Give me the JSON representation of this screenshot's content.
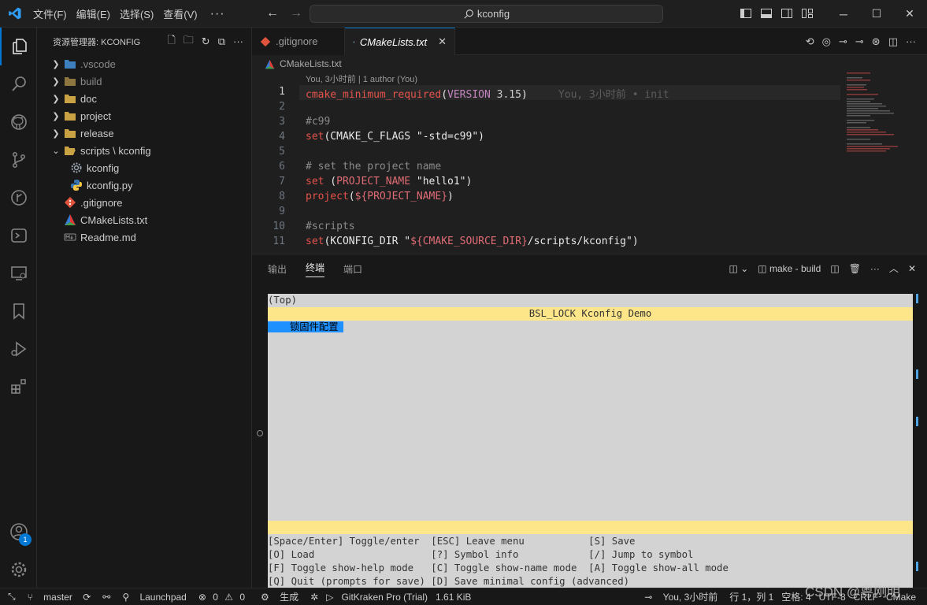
{
  "titlebar": {
    "menu": [
      "文件(F)",
      "编辑(E)",
      "选择(S)",
      "查看(V)",
      "···"
    ],
    "search_text": "kconfig"
  },
  "sidebar": {
    "title": "资源管理器: KCONFIG",
    "items": [
      {
        "label": ".vscode",
        "kind": "folder"
      },
      {
        "label": "build",
        "kind": "folder"
      },
      {
        "label": "doc",
        "kind": "folder"
      },
      {
        "label": "project",
        "kind": "folder"
      },
      {
        "label": "release",
        "kind": "folder"
      },
      {
        "label": "scripts \\ kconfig",
        "kind": "folder-open"
      },
      {
        "label": "kconfig",
        "kind": "gear-file"
      },
      {
        "label": "kconfig.py",
        "kind": "python-file"
      },
      {
        "label": ".gitignore",
        "kind": "git-file"
      },
      {
        "label": "CMakeLists.txt",
        "kind": "cmake-file"
      },
      {
        "label": "Readme.md",
        "kind": "markdown-file"
      }
    ]
  },
  "editor": {
    "tabs": [
      {
        "label": ".gitignore",
        "active": false
      },
      {
        "label": "CMakeLists.txt",
        "active": true
      }
    ],
    "breadcrumb": "CMakeLists.txt",
    "codelens": "You, 3小时前 | 1 author (You)",
    "inline_blame": "You, 3小时前 • init",
    "line_numbers": [
      "1",
      "2",
      "3",
      "4",
      "5",
      "6",
      "7",
      "8",
      "9",
      "10",
      "11"
    ],
    "code": {
      "l1_fn": "cmake_minimum_required",
      "l1_open": "(",
      "l1_kw": "VERSION",
      "l1_num": " 3.15",
      "l1_close": ")",
      "l3": "#c99",
      "l4_fn": "set",
      "l4_rest": "(CMAKE_C_FLAGS \"-std=c99\")",
      "l6": "# set the project name",
      "l7_fn": "set",
      "l7_a": " (",
      "l7_var": "PROJECT_NAME",
      "l7_str": " \"hello1\")",
      "l8_fn": "project",
      "l8_a": "(",
      "l8_var": "${PROJECT_NAME}",
      "l8_b": ")",
      "l10": "#scripts",
      "l11_fn": "set",
      "l11_a": "(KCONFIG_DIR \"",
      "l11_var": "${CMAKE_SOURCE_DIR}",
      "l11_b": "/scripts/kconfig\")"
    }
  },
  "panel": {
    "tabs": [
      "输出",
      "终端",
      "端口"
    ],
    "active_tab": "终端",
    "terminal_name": "make - build"
  },
  "terminal": {
    "top": "(Top)",
    "header": "BSL_LOCK Kconfig Demo",
    "selected_item": "锁固件配置",
    "help": [
      "[Space/Enter] Toggle/enter  [ESC] Leave menu           [S] Save",
      "[O] Load                    [?] Symbol info            [/] Jump to symbol",
      "[F] Toggle show-help mode   [C] Toggle show-name mode  [A] Toggle show-all mode",
      "[Q] Quit (prompts for save) [D] Save minimal config (advanced)"
    ]
  },
  "statusbar": {
    "branch": "master",
    "launchpad": "Launchpad",
    "errors": "0",
    "warnings": "0",
    "build": "生成",
    "gitkraken": "GitKraken Pro (Trial)",
    "size": "1.61 KiB",
    "blame": "You, 3小时前",
    "position": "行 1，列 1",
    "spaces": "空格: 4",
    "encoding": "UTF-8",
    "eol": "CRLF",
    "language": "CMake"
  },
  "watermark": "CSDN @粤刚明",
  "account_badge": "1",
  "colors": {
    "accent": "#0078d4",
    "terminal_bg": "#d3d3d3",
    "terminal_header": "#fde68a",
    "selection": "#1e90ff"
  }
}
